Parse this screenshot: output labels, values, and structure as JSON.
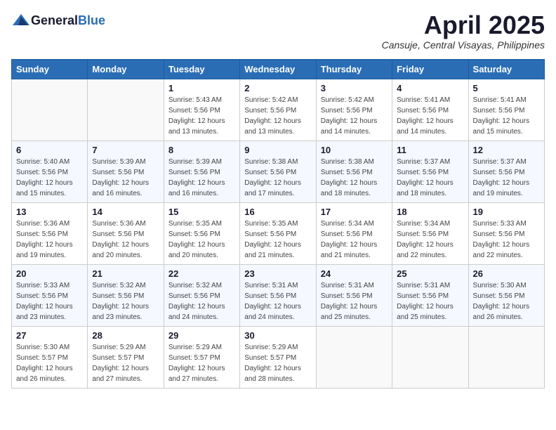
{
  "header": {
    "logo_general": "General",
    "logo_blue": "Blue",
    "title": "April 2025",
    "subtitle": "Cansuje, Central Visayas, Philippines"
  },
  "weekdays": [
    "Sunday",
    "Monday",
    "Tuesday",
    "Wednesday",
    "Thursday",
    "Friday",
    "Saturday"
  ],
  "weeks": [
    [
      {
        "day": "",
        "sunrise": "",
        "sunset": "",
        "daylight": ""
      },
      {
        "day": "",
        "sunrise": "",
        "sunset": "",
        "daylight": ""
      },
      {
        "day": "1",
        "sunrise": "Sunrise: 5:43 AM",
        "sunset": "Sunset: 5:56 PM",
        "daylight": "Daylight: 12 hours and 13 minutes."
      },
      {
        "day": "2",
        "sunrise": "Sunrise: 5:42 AM",
        "sunset": "Sunset: 5:56 PM",
        "daylight": "Daylight: 12 hours and 13 minutes."
      },
      {
        "day": "3",
        "sunrise": "Sunrise: 5:42 AM",
        "sunset": "Sunset: 5:56 PM",
        "daylight": "Daylight: 12 hours and 14 minutes."
      },
      {
        "day": "4",
        "sunrise": "Sunrise: 5:41 AM",
        "sunset": "Sunset: 5:56 PM",
        "daylight": "Daylight: 12 hours and 14 minutes."
      },
      {
        "day": "5",
        "sunrise": "Sunrise: 5:41 AM",
        "sunset": "Sunset: 5:56 PM",
        "daylight": "Daylight: 12 hours and 15 minutes."
      }
    ],
    [
      {
        "day": "6",
        "sunrise": "Sunrise: 5:40 AM",
        "sunset": "Sunset: 5:56 PM",
        "daylight": "Daylight: 12 hours and 15 minutes."
      },
      {
        "day": "7",
        "sunrise": "Sunrise: 5:39 AM",
        "sunset": "Sunset: 5:56 PM",
        "daylight": "Daylight: 12 hours and 16 minutes."
      },
      {
        "day": "8",
        "sunrise": "Sunrise: 5:39 AM",
        "sunset": "Sunset: 5:56 PM",
        "daylight": "Daylight: 12 hours and 16 minutes."
      },
      {
        "day": "9",
        "sunrise": "Sunrise: 5:38 AM",
        "sunset": "Sunset: 5:56 PM",
        "daylight": "Daylight: 12 hours and 17 minutes."
      },
      {
        "day": "10",
        "sunrise": "Sunrise: 5:38 AM",
        "sunset": "Sunset: 5:56 PM",
        "daylight": "Daylight: 12 hours and 18 minutes."
      },
      {
        "day": "11",
        "sunrise": "Sunrise: 5:37 AM",
        "sunset": "Sunset: 5:56 PM",
        "daylight": "Daylight: 12 hours and 18 minutes."
      },
      {
        "day": "12",
        "sunrise": "Sunrise: 5:37 AM",
        "sunset": "Sunset: 5:56 PM",
        "daylight": "Daylight: 12 hours and 19 minutes."
      }
    ],
    [
      {
        "day": "13",
        "sunrise": "Sunrise: 5:36 AM",
        "sunset": "Sunset: 5:56 PM",
        "daylight": "Daylight: 12 hours and 19 minutes."
      },
      {
        "day": "14",
        "sunrise": "Sunrise: 5:36 AM",
        "sunset": "Sunset: 5:56 PM",
        "daylight": "Daylight: 12 hours and 20 minutes."
      },
      {
        "day": "15",
        "sunrise": "Sunrise: 5:35 AM",
        "sunset": "Sunset: 5:56 PM",
        "daylight": "Daylight: 12 hours and 20 minutes."
      },
      {
        "day": "16",
        "sunrise": "Sunrise: 5:35 AM",
        "sunset": "Sunset: 5:56 PM",
        "daylight": "Daylight: 12 hours and 21 minutes."
      },
      {
        "day": "17",
        "sunrise": "Sunrise: 5:34 AM",
        "sunset": "Sunset: 5:56 PM",
        "daylight": "Daylight: 12 hours and 21 minutes."
      },
      {
        "day": "18",
        "sunrise": "Sunrise: 5:34 AM",
        "sunset": "Sunset: 5:56 PM",
        "daylight": "Daylight: 12 hours and 22 minutes."
      },
      {
        "day": "19",
        "sunrise": "Sunrise: 5:33 AM",
        "sunset": "Sunset: 5:56 PM",
        "daylight": "Daylight: 12 hours and 22 minutes."
      }
    ],
    [
      {
        "day": "20",
        "sunrise": "Sunrise: 5:33 AM",
        "sunset": "Sunset: 5:56 PM",
        "daylight": "Daylight: 12 hours and 23 minutes."
      },
      {
        "day": "21",
        "sunrise": "Sunrise: 5:32 AM",
        "sunset": "Sunset: 5:56 PM",
        "daylight": "Daylight: 12 hours and 23 minutes."
      },
      {
        "day": "22",
        "sunrise": "Sunrise: 5:32 AM",
        "sunset": "Sunset: 5:56 PM",
        "daylight": "Daylight: 12 hours and 24 minutes."
      },
      {
        "day": "23",
        "sunrise": "Sunrise: 5:31 AM",
        "sunset": "Sunset: 5:56 PM",
        "daylight": "Daylight: 12 hours and 24 minutes."
      },
      {
        "day": "24",
        "sunrise": "Sunrise: 5:31 AM",
        "sunset": "Sunset: 5:56 PM",
        "daylight": "Daylight: 12 hours and 25 minutes."
      },
      {
        "day": "25",
        "sunrise": "Sunrise: 5:31 AM",
        "sunset": "Sunset: 5:56 PM",
        "daylight": "Daylight: 12 hours and 25 minutes."
      },
      {
        "day": "26",
        "sunrise": "Sunrise: 5:30 AM",
        "sunset": "Sunset: 5:56 PM",
        "daylight": "Daylight: 12 hours and 26 minutes."
      }
    ],
    [
      {
        "day": "27",
        "sunrise": "Sunrise: 5:30 AM",
        "sunset": "Sunset: 5:57 PM",
        "daylight": "Daylight: 12 hours and 26 minutes."
      },
      {
        "day": "28",
        "sunrise": "Sunrise: 5:29 AM",
        "sunset": "Sunset: 5:57 PM",
        "daylight": "Daylight: 12 hours and 27 minutes."
      },
      {
        "day": "29",
        "sunrise": "Sunrise: 5:29 AM",
        "sunset": "Sunset: 5:57 PM",
        "daylight": "Daylight: 12 hours and 27 minutes."
      },
      {
        "day": "30",
        "sunrise": "Sunrise: 5:29 AM",
        "sunset": "Sunset: 5:57 PM",
        "daylight": "Daylight: 12 hours and 28 minutes."
      },
      {
        "day": "",
        "sunrise": "",
        "sunset": "",
        "daylight": ""
      },
      {
        "day": "",
        "sunrise": "",
        "sunset": "",
        "daylight": ""
      },
      {
        "day": "",
        "sunrise": "",
        "sunset": "",
        "daylight": ""
      }
    ]
  ]
}
